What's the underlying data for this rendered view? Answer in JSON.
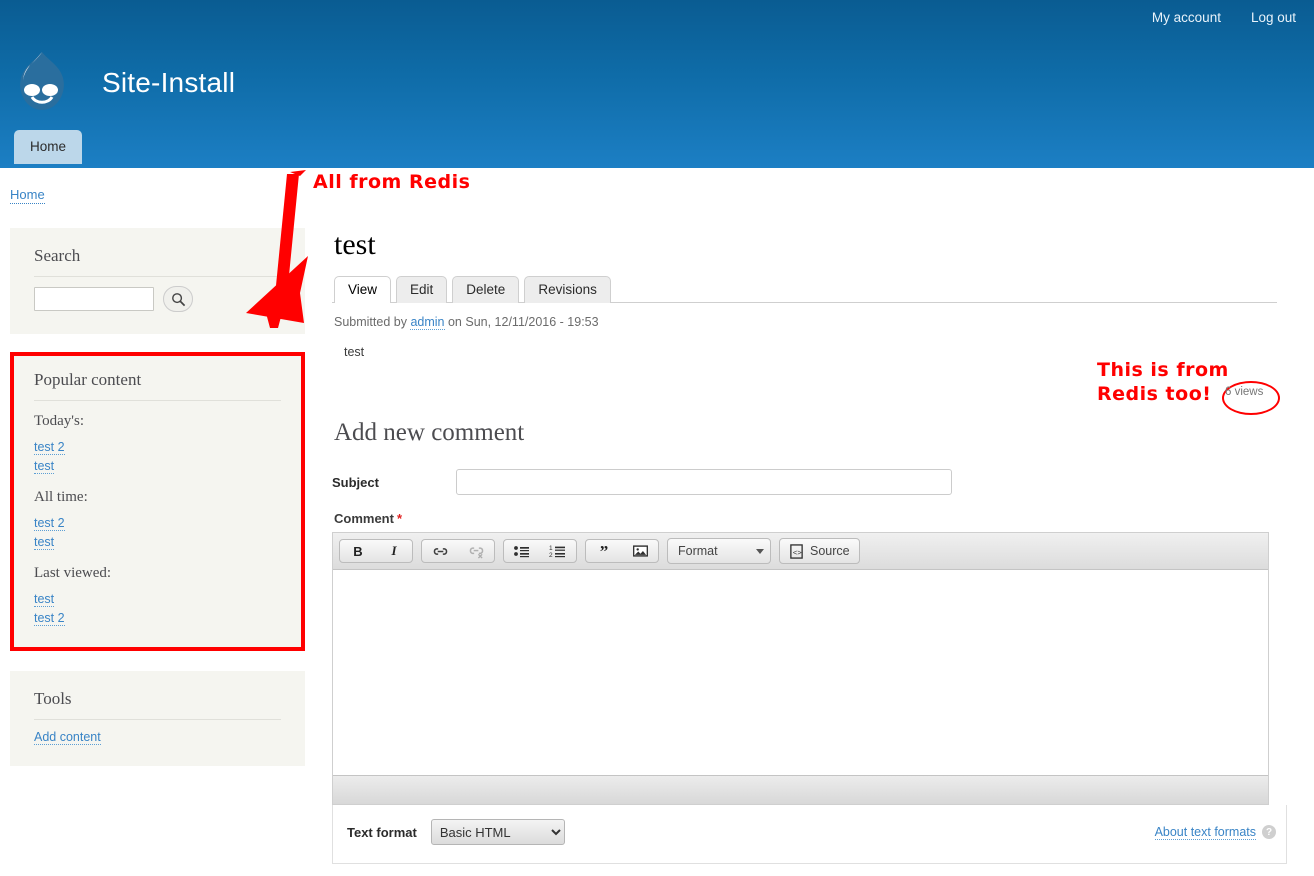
{
  "header": {
    "site_name": "Site-Install",
    "logo_icon": "drupal-drop-logo",
    "user_links": [
      {
        "label": "My account"
      },
      {
        "label": "Log out"
      }
    ],
    "primary_tab": "Home"
  },
  "breadcrumb": {
    "home_label": "Home"
  },
  "sidebar": {
    "search_block": {
      "title": "Search",
      "input_value": "",
      "input_placeholder": "",
      "button_icon": "search-icon"
    },
    "popular_block": {
      "title": "Popular content",
      "groups": [
        {
          "label": "Today's:",
          "items": [
            "test 2",
            "test"
          ]
        },
        {
          "label": "All time:",
          "items": [
            "test 2",
            "test"
          ]
        },
        {
          "label": "Last viewed:",
          "items": [
            "test",
            "test 2"
          ]
        }
      ]
    },
    "tools_block": {
      "title": "Tools",
      "items": [
        "Add content"
      ]
    }
  },
  "main": {
    "page_title": "test",
    "tabs": [
      {
        "label": "View",
        "active": true
      },
      {
        "label": "Edit",
        "active": false
      },
      {
        "label": "Delete",
        "active": false
      },
      {
        "label": "Revisions",
        "active": false
      }
    ],
    "submitted_prefix": "Submitted by",
    "submitted_author": "admin",
    "submitted_suffix": "on Sun, 12/11/2016 - 19:53",
    "body_text": "test",
    "views_badge": "6 views"
  },
  "comment_form": {
    "heading": "Add new comment",
    "subject_label": "Subject",
    "subject_value": "",
    "subject_placeholder": "",
    "comment_label": "Comment",
    "required_marker": "*",
    "editor": {
      "bold": "B",
      "italic": "I",
      "link_icon": "link-icon",
      "unlink_icon": "unlink-icon",
      "bulleted_list_icon": "bulleted-list-icon",
      "numbered_list_icon": "numbered-list-icon",
      "blockquote_icon": "blockquote-icon",
      "image_icon": "image-icon",
      "format_label": "Format",
      "source_label": "Source",
      "source_icon": "source-code-icon",
      "content": ""
    },
    "text_format_label": "Text format",
    "text_format_value": "Basic HTML",
    "text_format_options": [
      "Basic HTML"
    ],
    "about_formats_label": "About text formats",
    "help_icon": "question-mark-icon"
  },
  "annotations": {
    "sidebar_note": "All from Redis",
    "views_note_line1": "This is from",
    "views_note_line2": "Redis too!",
    "color": "#ff0000"
  }
}
